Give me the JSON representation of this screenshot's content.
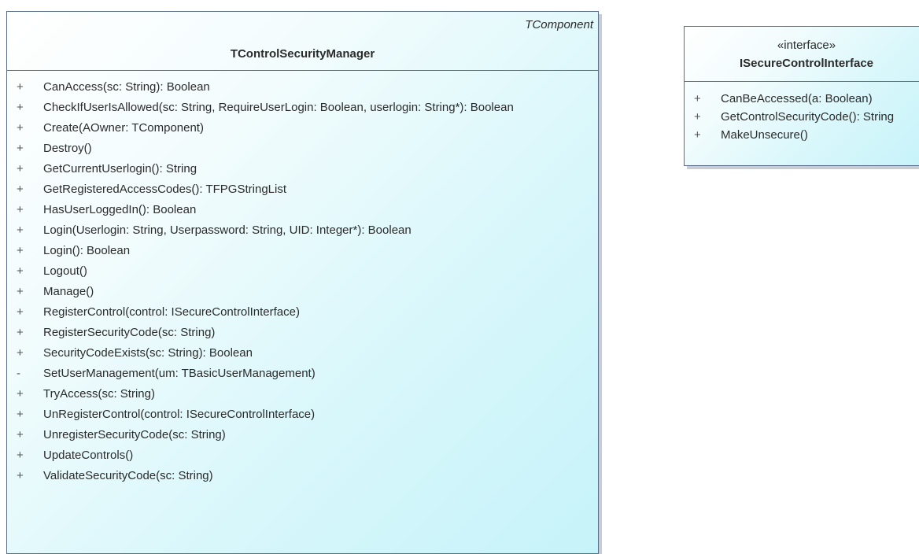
{
  "main_class": {
    "parent": "TComponent",
    "name": "TControlSecurityManager",
    "operations": [
      {
        "vis": "+",
        "sig": "CanAccess(sc: String): Boolean"
      },
      {
        "vis": "+",
        "sig": "CheckIfUserIsAllowed(sc: String, RequireUserLogin: Boolean, userlogin: String*): Boolean"
      },
      {
        "vis": "+",
        "sig": "Create(AOwner: TComponent)"
      },
      {
        "vis": "+",
        "sig": "Destroy()"
      },
      {
        "vis": "+",
        "sig": "GetCurrentUserlogin(): String"
      },
      {
        "vis": "+",
        "sig": "GetRegisteredAccessCodes(): TFPGStringList"
      },
      {
        "vis": "+",
        "sig": "HasUserLoggedIn(): Boolean"
      },
      {
        "vis": "+",
        "sig": "Login(Userlogin: String, Userpassword: String, UID: Integer*): Boolean"
      },
      {
        "vis": "+",
        "sig": "Login(): Boolean"
      },
      {
        "vis": "+",
        "sig": "Logout()"
      },
      {
        "vis": "+",
        "sig": "Manage()"
      },
      {
        "vis": "+",
        "sig": "RegisterControl(control: ISecureControlInterface)"
      },
      {
        "vis": "+",
        "sig": "RegisterSecurityCode(sc: String)"
      },
      {
        "vis": "+",
        "sig": "SecurityCodeExists(sc: String): Boolean"
      },
      {
        "vis": "-",
        "sig": "SetUserManagement(um: TBasicUserManagement)"
      },
      {
        "vis": "+",
        "sig": "TryAccess(sc: String)"
      },
      {
        "vis": "+",
        "sig": "UnRegisterControl(control: ISecureControlInterface)"
      },
      {
        "vis": "+",
        "sig": "UnregisterSecurityCode(sc: String)"
      },
      {
        "vis": "+",
        "sig": "UpdateControls()"
      },
      {
        "vis": "+",
        "sig": "ValidateSecurityCode(sc: String)"
      }
    ]
  },
  "interface_class": {
    "stereotype": "«interface»",
    "name": "ISecureControlInterface",
    "operations": [
      {
        "vis": "+",
        "sig": "CanBeAccessed(a: Boolean)"
      },
      {
        "vis": "+",
        "sig": "GetControlSecurityCode(): String"
      },
      {
        "vis": "+",
        "sig": "MakeUnsecure()"
      }
    ]
  }
}
